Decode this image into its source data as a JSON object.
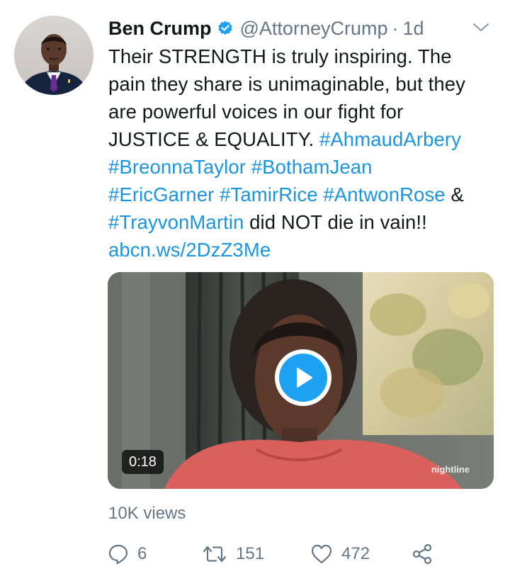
{
  "tweet": {
    "author": {
      "display_name": "Ben Crump",
      "handle": "@AttorneyCrump",
      "verified": true,
      "avatar_icon": "profile-photo"
    },
    "separator": "·",
    "time": "1d",
    "menu_icon": "chevron-down-icon",
    "text_lines": [
      [
        {
          "text": "Their STRENGTH is truly inspiring. The",
          "link": false
        }
      ],
      [
        {
          "text": "pain they share is unimaginable, but they",
          "link": false
        }
      ],
      [
        {
          "text": "are powerful voices in our fight for",
          "link": false
        }
      ],
      [
        {
          "text": "JUSTICE & EQUALITY. ",
          "link": false
        },
        {
          "text": "#AhmaudArbery",
          "link": true
        }
      ],
      [
        {
          "text": "#BreonnaTaylor",
          "link": true
        },
        {
          "text": " ",
          "link": false
        },
        {
          "text": "#BothamJean",
          "link": true
        }
      ],
      [
        {
          "text": "#EricGarner",
          "link": true
        },
        {
          "text": " ",
          "link": false
        },
        {
          "text": "#TamirRice",
          "link": true
        },
        {
          "text": " ",
          "link": false
        },
        {
          "text": "#AntwonRose",
          "link": true
        },
        {
          "text": " &",
          "link": false
        }
      ],
      [
        {
          "text": "#TrayvonMartin",
          "link": true
        },
        {
          "text": " did NOT die in vain!!",
          "link": false
        }
      ],
      [
        {
          "text": "abcn.ws/2DzZ3Me",
          "link": true
        }
      ]
    ],
    "media": {
      "duration": "0:18",
      "watermark": "nightline",
      "play_icon": "play-icon"
    },
    "views": "10K views",
    "actions": {
      "replies": "6",
      "retweets": "151",
      "likes": "472"
    },
    "colors": {
      "link": "#1b95e0",
      "secondary": "#657786",
      "play": "#1da1f2"
    }
  }
}
